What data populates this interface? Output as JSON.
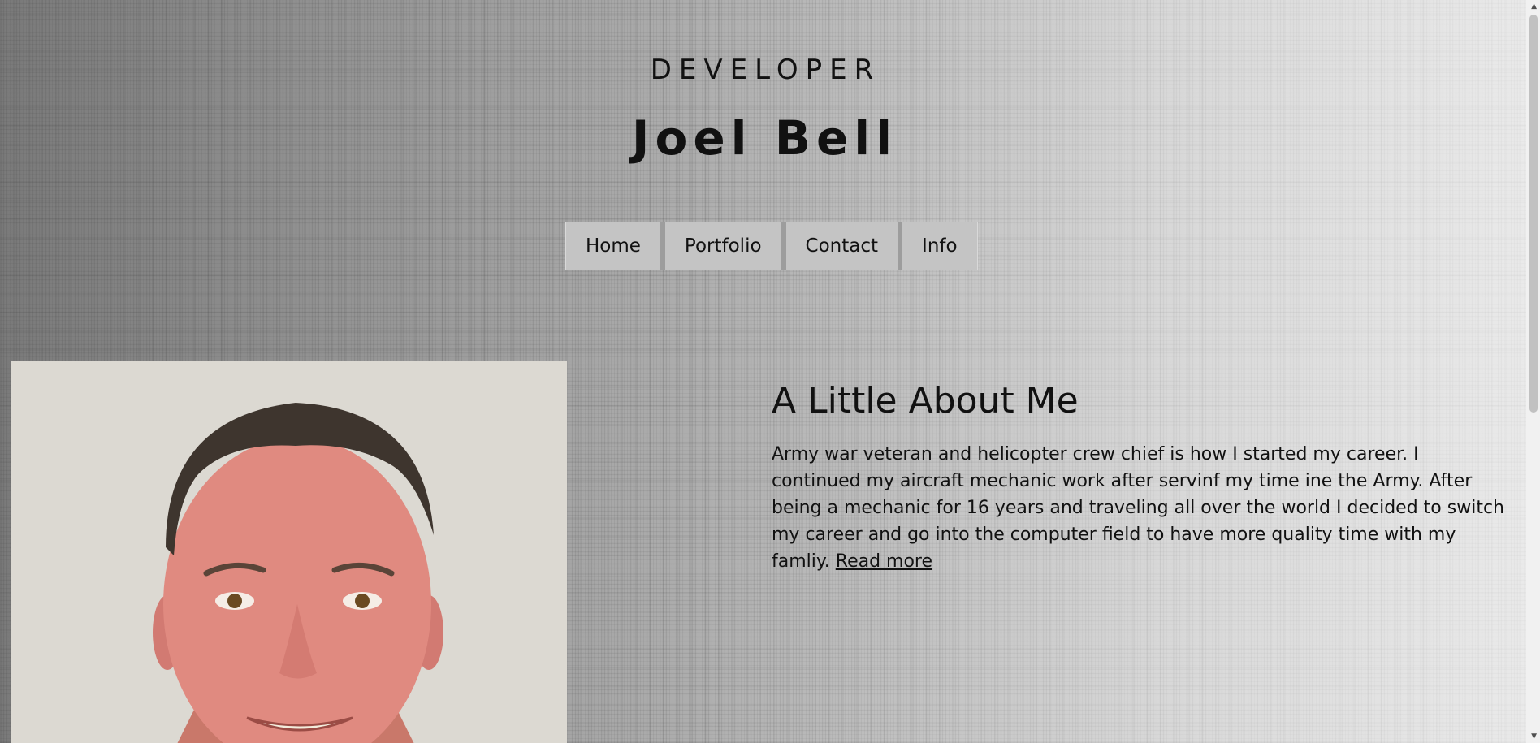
{
  "header": {
    "subtitle": "DEVELOPER",
    "title": "Joel Bell"
  },
  "nav": {
    "items": [
      {
        "label": "Home"
      },
      {
        "label": "Portfolio"
      },
      {
        "label": "Contact"
      },
      {
        "label": "Info"
      }
    ]
  },
  "about": {
    "heading": "A Little About Me",
    "body": "Army war veteran and helicopter crew chief is how I started my career. I continued my aircraft mechanic work after servinf my time ine the Army. After being a mechanic for 16 years and traveling all over the world I decided to switch my career and go into the computer field to have more quality time with my famliy.",
    "read_more": "Read more"
  },
  "scrollbar": {
    "up_icon": "triangle-up-icon",
    "down_icon": "chevron-down-icon"
  }
}
